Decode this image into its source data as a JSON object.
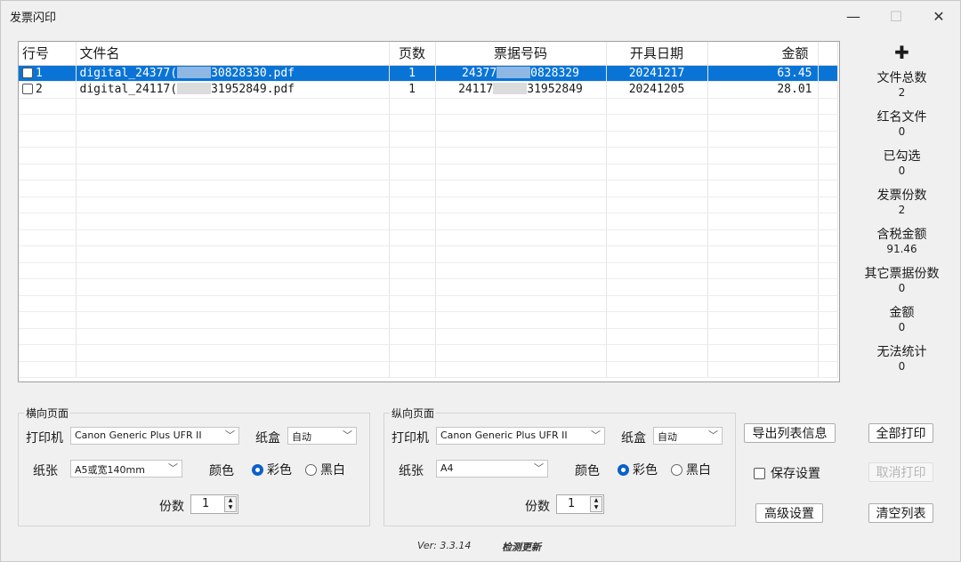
{
  "window": {
    "title": "发票闪印",
    "minimize_icon": "minimize-icon",
    "maximize_icon": "maximize-icon",
    "close_icon": "close-icon"
  },
  "table": {
    "headers": [
      "行号",
      "文件名",
      "页数",
      "票据号码",
      "开具日期",
      "金额"
    ],
    "rows": [
      {
        "row": "1",
        "file_pre": "digital_24377(",
        "file_post": "30828330.pdf",
        "pages": "1",
        "no_pre": "24377",
        "no_post": "0828329",
        "date": "20241217",
        "amount": "63.45"
      },
      {
        "row": "2",
        "file_pre": "digital_24117(",
        "file_post": "31952849.pdf",
        "pages": "1",
        "no_pre": "24117",
        "no_post": "31952849",
        "date": "20241205",
        "amount": "28.01"
      }
    ]
  },
  "stats": {
    "plus": "✚",
    "items": [
      {
        "label": "文件总数",
        "value": "2"
      },
      {
        "label": "红名文件",
        "value": "0"
      },
      {
        "label": "已勾选",
        "value": "0"
      },
      {
        "label": "发票份数",
        "value": "2"
      },
      {
        "label": "含税金额",
        "value": "91.46"
      },
      {
        "label": "其它票据份数",
        "value": "0"
      },
      {
        "label": "金额",
        "value": "0"
      },
      {
        "label": "无法统计",
        "value": "0"
      }
    ]
  },
  "landscape": {
    "title": "横向页面",
    "printer_label": "打印机",
    "printer": "Canon Generic Plus UFR II",
    "tray_label": "纸盒",
    "tray": "自动",
    "paper_label": "纸张",
    "paper": "A5或宽140mm",
    "color_label": "颜色",
    "color_opt": "彩色",
    "bw_opt": "黑白",
    "copies_label": "份数",
    "copies": "1"
  },
  "portrait": {
    "title": "纵向页面",
    "printer_label": "打印机",
    "printer": "Canon Generic Plus UFR II",
    "tray_label": "纸盒",
    "tray": "自动",
    "paper_label": "纸张",
    "paper": "A4",
    "color_label": "颜色",
    "color_opt": "彩色",
    "bw_opt": "黑白",
    "copies_label": "份数",
    "copies": "1"
  },
  "actions": {
    "export": "导出列表信息",
    "print_all": "全部打印",
    "save_settings": "保存设置",
    "cancel_print": "取消打印",
    "advanced": "高级设置",
    "clear_list": "清空列表"
  },
  "footer": {
    "version": "Ver: 3.3.14",
    "check_update": "检测更新"
  }
}
